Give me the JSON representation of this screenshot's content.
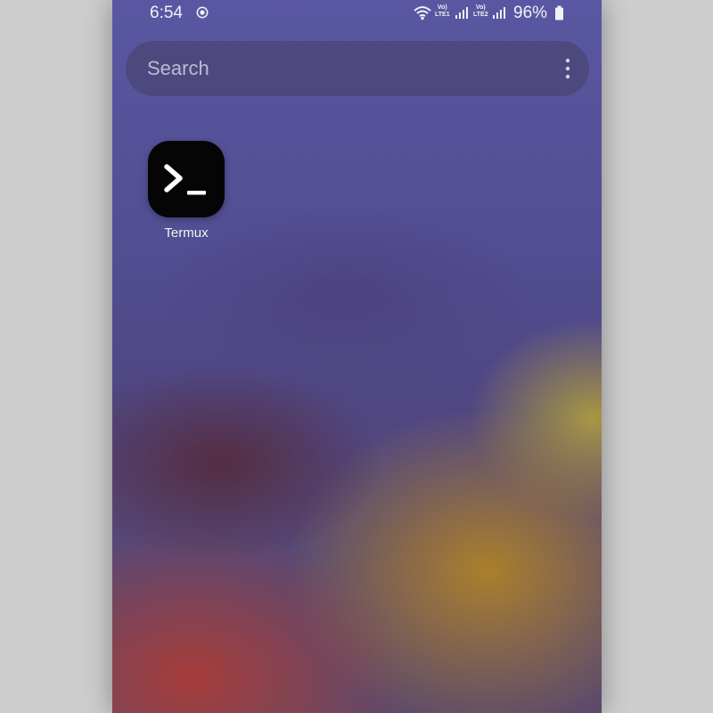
{
  "status_bar": {
    "time": "6:54",
    "network": {
      "sim1_line1": "Vo)",
      "sim1_line2": "LTE1",
      "sim2_line1": "Vo)",
      "sim2_line2": "LTE2"
    },
    "battery_percent": "96%",
    "icons": [
      "screen-recording-icon",
      "wifi-icon",
      "signal-icon",
      "signal-icon",
      "battery-icon"
    ]
  },
  "search": {
    "placeholder": "Search"
  },
  "apps": [
    {
      "label": "Termux",
      "icon": "terminal-icon"
    }
  ],
  "colors": {
    "wallpaper_top": "#5a57a2",
    "wallpaper_red": "#aa3c37",
    "wallpaper_yellow": "#af8228",
    "app_icon_background": "#050505",
    "search_bar": "#4d497e"
  }
}
